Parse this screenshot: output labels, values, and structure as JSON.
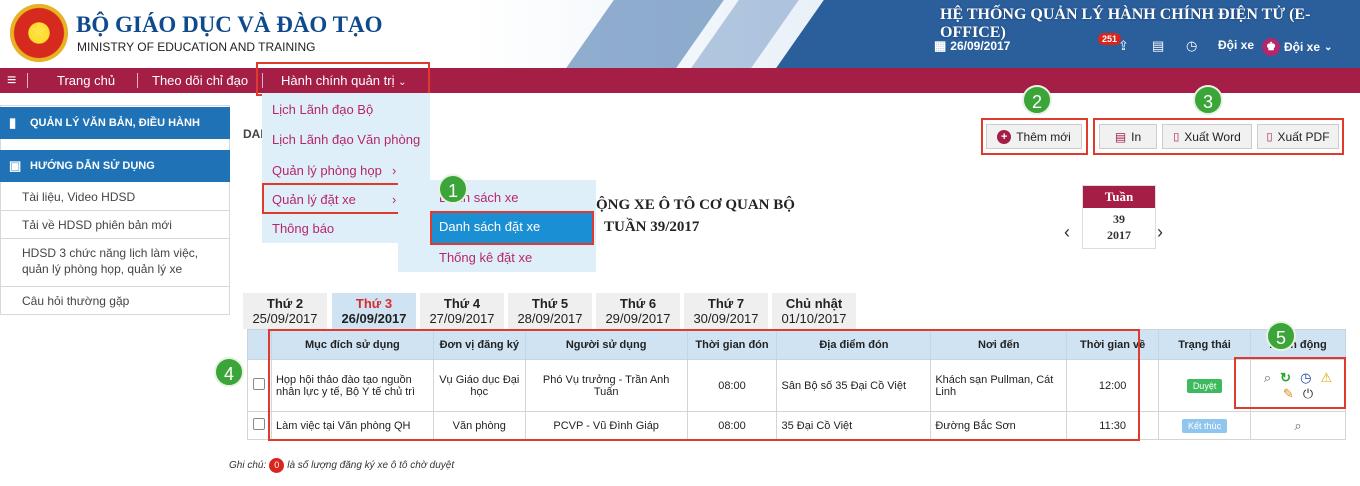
{
  "header": {
    "org_vi": "BỘ GIÁO DỤC VÀ ĐÀO TẠO",
    "org_en": "MINISTRY OF EDUCATION AND TRAINING",
    "system_title": "HỆ THỐNG QUẢN LÝ HÀNH CHÍNH ĐIỆN TỬ (E-OFFICE)",
    "date": "26/09/2017",
    "notification_count": "251",
    "role_label": "Đội xe",
    "user_label": "Đội xe"
  },
  "nav": {
    "menu_icon": "hamburger-icon",
    "items": [
      "Trang chủ",
      "Theo dõi chỉ đạo",
      "Hành chính quản trị"
    ]
  },
  "dropdown": {
    "items": [
      "Lịch Lãnh đạo Bộ",
      "Lịch Lãnh đạo Văn phòng",
      "Quản lý phòng họp",
      "Quản lý đặt xe",
      "Thông báo"
    ]
  },
  "submenu": {
    "items": [
      "Danh sách xe",
      "Danh sách đặt xe",
      "Thống kê đặt xe"
    ]
  },
  "sidebar": {
    "section1": "QUẢN LÝ VĂN BẢN, ĐIỀU HÀNH",
    "section2": "HƯỚNG DẪN SỬ DỤNG",
    "items": [
      "Tài liệu, Video HDSD",
      "Tải về HDSD phiên bản mới",
      "HDSD 3 chức năng lịch làm việc, quản lý phòng họp, quản lý xe",
      "Câu hỏi thường gặp"
    ]
  },
  "main": {
    "breadcrumb": "DAN",
    "title_line1": "ỘNG XE Ô TÔ CƠ QUAN BỘ",
    "title_line2": "TUẦN 39/2017",
    "buttons": {
      "add": "Thêm mới",
      "print": "In",
      "word": "Xuất Word",
      "pdf": "Xuất PDF"
    },
    "week": {
      "label": "Tuần",
      "number": "39",
      "year": "2017"
    },
    "days": [
      {
        "name": "Thứ 2",
        "date": "25/09/2017"
      },
      {
        "name": "Thứ 3",
        "date": "26/09/2017"
      },
      {
        "name": "Thứ 4",
        "date": "27/09/2017"
      },
      {
        "name": "Thứ 5",
        "date": "28/09/2017"
      },
      {
        "name": "Thứ 6",
        "date": "29/09/2017"
      },
      {
        "name": "Thứ 7",
        "date": "30/09/2017"
      },
      {
        "name": "Chủ nhật",
        "date": "01/10/2017"
      }
    ],
    "table": {
      "headers": [
        "Mục đích sử dụng",
        "Đơn vị đăng ký",
        "Người sử dụng",
        "Thời gian đón",
        "Địa điểm đón",
        "Nơi đến",
        "Thời gian về",
        "Trạng thái",
        "Hành động"
      ],
      "rows": [
        {
          "purpose": "Họp hội thảo đào tạo nguồn nhân lực y tế, Bộ Y tế chủ trì",
          "unit": "Vụ Giáo dục Đại học",
          "user": "Phó Vụ trưởng - Trần Anh Tuấn",
          "pickup_time": "08:00",
          "pickup_place": "Sân Bộ số 35 Đại Cồ Việt",
          "destination": "Khách sạn Pullman, Cát Linh",
          "return_time": "12:00",
          "status": "Duyệt",
          "status_color": "#3dba5d"
        },
        {
          "purpose": "Làm việc tại Văn phòng QH",
          "unit": "Văn phòng",
          "user": "PCVP - Vũ Đình Giáp",
          "pickup_time": "08:00",
          "pickup_place": "35 Đại Cồ Việt",
          "destination": "Đường Bắc Sơn",
          "return_time": "11:30",
          "status": "Kết thúc",
          "status_color": "#8fc6ee"
        }
      ]
    },
    "note": {
      "prefix": "Ghi chú:",
      "count": "0",
      "suffix": "là số lượng đăng ký xe ô tô chờ duyệt"
    }
  },
  "callouts": [
    "1",
    "2",
    "3",
    "4",
    "5"
  ],
  "colors": {
    "nav": "#a41e46",
    "sidebar_head": "#1f72b5",
    "highlight": "#e0392e",
    "callout": "#3ba539",
    "submenu_active": "#1b8fd3"
  }
}
